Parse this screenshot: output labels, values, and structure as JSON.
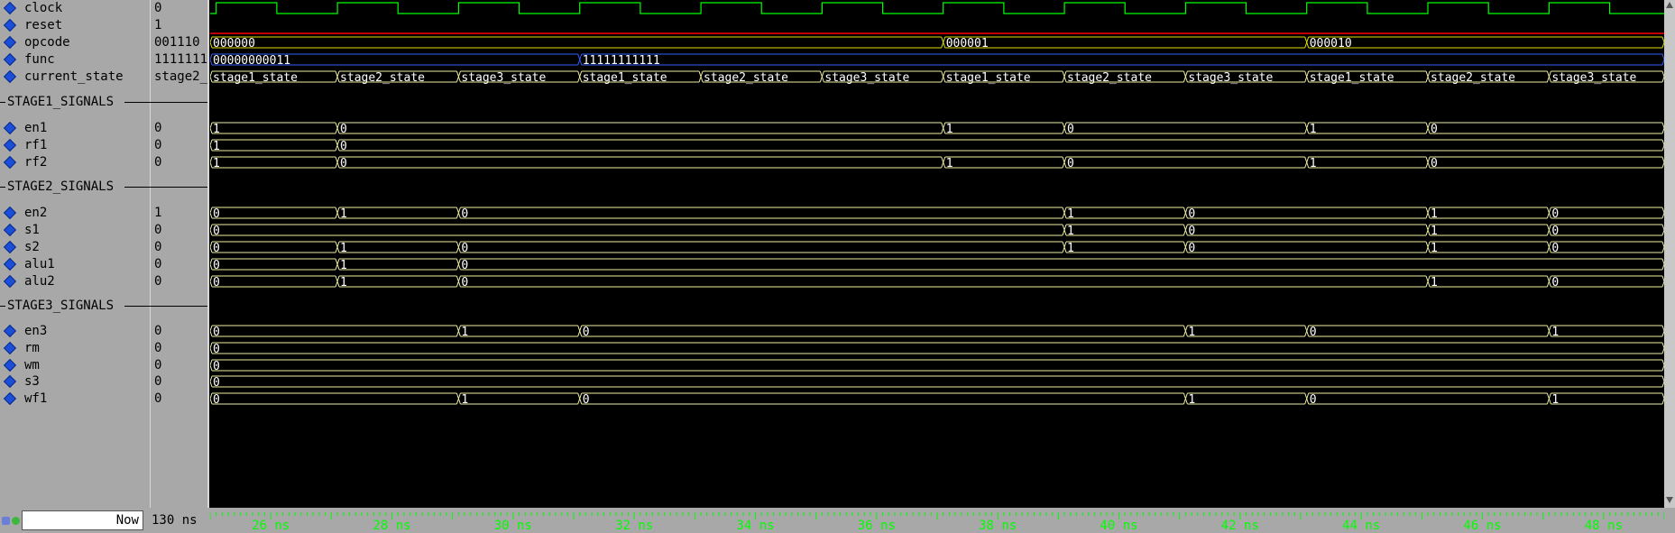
{
  "signals": [
    {
      "name": "clock",
      "value": "0"
    },
    {
      "name": "reset",
      "value": "1"
    },
    {
      "name": "opcode",
      "value": "001110"
    },
    {
      "name": "func",
      "value": "1111111"
    },
    {
      "name": "current_state",
      "value": "stage2_"
    },
    {
      "group": "STAGE1_SIGNALS"
    },
    {
      "name": "en1",
      "value": "0"
    },
    {
      "name": "rf1",
      "value": "0"
    },
    {
      "name": "rf2",
      "value": "0"
    },
    {
      "group": "STAGE2_SIGNALS"
    },
    {
      "name": "en2",
      "value": "1"
    },
    {
      "name": "s1",
      "value": "0"
    },
    {
      "name": "s2",
      "value": "0"
    },
    {
      "name": "alu1",
      "value": "0"
    },
    {
      "name": "alu2",
      "value": "0"
    },
    {
      "group": "STAGE3_SIGNALS"
    },
    {
      "name": "en3",
      "value": "0"
    },
    {
      "name": "rm",
      "value": "0"
    },
    {
      "name": "wm",
      "value": "0"
    },
    {
      "name": "s3",
      "value": "0"
    },
    {
      "name": "wf1",
      "value": "0"
    }
  ],
  "waves": {
    "opcode": [
      {
        "t": 25,
        "v": "000000"
      },
      {
        "t": 37.1,
        "v": "000001"
      },
      {
        "t": 43.1,
        "v": "000010"
      }
    ],
    "func": [
      {
        "t": 25,
        "v": "00000000011"
      },
      {
        "t": 31.1,
        "v": "11111111111"
      }
    ],
    "current_state": [
      {
        "t": 25,
        "v": "stage1_state"
      },
      {
        "t": 27.1,
        "v": "stage2_state"
      },
      {
        "t": 29.1,
        "v": "stage3_state"
      },
      {
        "t": 31.1,
        "v": "stage1_state"
      },
      {
        "t": 33.1,
        "v": "stage2_state"
      },
      {
        "t": 35.1,
        "v": "stage3_state"
      },
      {
        "t": 37.1,
        "v": "stage1_state"
      },
      {
        "t": 39.1,
        "v": "stage2_state"
      },
      {
        "t": 41.1,
        "v": "stage3_state"
      },
      {
        "t": 43.1,
        "v": "stage1_state"
      },
      {
        "t": 45.1,
        "v": "stage2_state"
      },
      {
        "t": 47.1,
        "v": "stage3_state"
      }
    ],
    "en1": [
      {
        "t": 25,
        "v": "1"
      },
      {
        "t": 27.1,
        "v": "0"
      },
      {
        "t": 37.1,
        "v": "1"
      },
      {
        "t": 39.1,
        "v": "0"
      },
      {
        "t": 43.1,
        "v": "1"
      },
      {
        "t": 45.1,
        "v": "0"
      }
    ],
    "rf1": [
      {
        "t": 25,
        "v": "1"
      },
      {
        "t": 27.1,
        "v": "0"
      }
    ],
    "rf2": [
      {
        "t": 25,
        "v": "1"
      },
      {
        "t": 27.1,
        "v": "0"
      },
      {
        "t": 37.1,
        "v": "1"
      },
      {
        "t": 39.1,
        "v": "0"
      },
      {
        "t": 43.1,
        "v": "1"
      },
      {
        "t": 45.1,
        "v": "0"
      }
    ],
    "en2": [
      {
        "t": 25,
        "v": "0"
      },
      {
        "t": 27.1,
        "v": "1"
      },
      {
        "t": 29.1,
        "v": "0"
      },
      {
        "t": 39.1,
        "v": "1"
      },
      {
        "t": 41.1,
        "v": "0"
      },
      {
        "t": 45.1,
        "v": "1"
      },
      {
        "t": 47.1,
        "v": "0"
      }
    ],
    "s1": [
      {
        "t": 25,
        "v": "0"
      },
      {
        "t": 39.1,
        "v": "1"
      },
      {
        "t": 41.1,
        "v": "0"
      },
      {
        "t": 45.1,
        "v": "1"
      },
      {
        "t": 47.1,
        "v": "0"
      }
    ],
    "s2": [
      {
        "t": 25,
        "v": "0"
      },
      {
        "t": 27.1,
        "v": "1"
      },
      {
        "t": 29.1,
        "v": "0"
      },
      {
        "t": 39.1,
        "v": "1"
      },
      {
        "t": 41.1,
        "v": "0"
      },
      {
        "t": 45.1,
        "v": "1"
      },
      {
        "t": 47.1,
        "v": "0"
      }
    ],
    "alu1": [
      {
        "t": 25,
        "v": "0"
      },
      {
        "t": 27.1,
        "v": "1"
      },
      {
        "t": 29.1,
        "v": "0"
      }
    ],
    "alu2": [
      {
        "t": 25,
        "v": "0"
      },
      {
        "t": 27.1,
        "v": "1"
      },
      {
        "t": 29.1,
        "v": "0"
      },
      {
        "t": 45.1,
        "v": "1"
      },
      {
        "t": 47.1,
        "v": "0"
      }
    ],
    "en3": [
      {
        "t": 25,
        "v": "0"
      },
      {
        "t": 29.1,
        "v": "1"
      },
      {
        "t": 31.1,
        "v": "0"
      },
      {
        "t": 41.1,
        "v": "1"
      },
      {
        "t": 43.1,
        "v": "0"
      },
      {
        "t": 47.1,
        "v": "1"
      }
    ],
    "rm": [
      {
        "t": 25,
        "v": "0"
      }
    ],
    "wm": [
      {
        "t": 25,
        "v": "0"
      }
    ],
    "s3": [
      {
        "t": 25,
        "v": "0"
      }
    ],
    "wf1": [
      {
        "t": 25,
        "v": "0"
      },
      {
        "t": 29.1,
        "v": "1"
      },
      {
        "t": 31.1,
        "v": "0"
      },
      {
        "t": 41.1,
        "v": "1"
      },
      {
        "t": 43.1,
        "v": "0"
      },
      {
        "t": 47.1,
        "v": "1"
      }
    ]
  },
  "time_range_ns": [
    25,
    49
  ],
  "time_labels": [
    "26 ns",
    "28 ns",
    "30 ns",
    "32 ns",
    "34 ns",
    "36 ns",
    "38 ns",
    "40 ns",
    "42 ns",
    "44 ns",
    "46 ns",
    "48 ns"
  ],
  "now": {
    "label": "Now",
    "value": "130 ns"
  },
  "icons": {
    "wave_icon": "wave-icon",
    "add_icon": "add-icon",
    "scroll_up": "scroll-up-icon",
    "scroll_down": "scroll-down-icon"
  },
  "colors": {
    "bus": "#f0f0a0",
    "logic": "#a0ffa0",
    "clock": "#00ff00",
    "reset": "#ff0000",
    "opcode": "#e0e000",
    "func": "#3060ff",
    "text": "#ffffff",
    "timeline": "#00ff00"
  }
}
